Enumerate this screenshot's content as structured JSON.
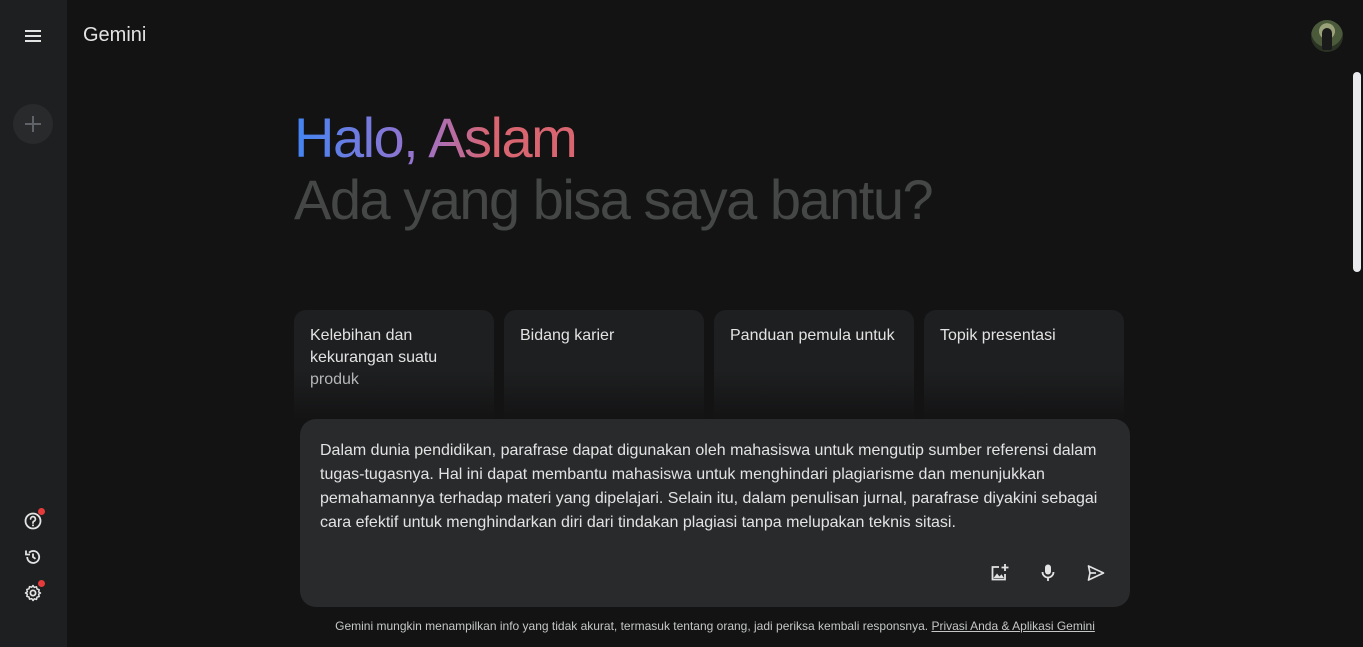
{
  "app": {
    "title": "Gemini"
  },
  "sidebar": {
    "menu_icon": "menu-icon",
    "new_chat_icon": "plus-icon",
    "bottom": [
      {
        "name": "help",
        "icon": "help-icon",
        "badge": true
      },
      {
        "name": "activity",
        "icon": "history-icon",
        "badge": false
      },
      {
        "name": "settings",
        "icon": "gear-icon",
        "badge": true
      }
    ]
  },
  "greeting": {
    "hello": "Halo, Aslam",
    "question": "Ada yang bisa saya bantu?"
  },
  "suggestions": [
    {
      "line": "Kelebihan dan kekurangan suatu",
      "faded": "produk"
    },
    {
      "line": "Bidang karier",
      "faded": ""
    },
    {
      "line": "Panduan pemula untuk",
      "faded": ""
    },
    {
      "line": "Topik presentasi",
      "faded": ""
    }
  ],
  "prompt": {
    "text": "Dalam dunia pendidikan, parafrase dapat digunakan oleh mahasiswa untuk mengutip sumber referensi dalam tugas-tugasnya. Hal ini dapat membantu mahasiswa untuk menghindari plagiarisme dan menunjukkan pemahamannya terhadap materi yang dipelajari. Selain itu, dalam penulisan jurnal, parafrase diyakini sebagai cara efektif untuk menghindarkan diri dari tindakan plagiasi tanpa melupakan teknis sitasi.",
    "actions": [
      "add-image-icon",
      "microphone-icon",
      "send-icon"
    ]
  },
  "footer": {
    "disclaimer": "Gemini mungkin menampilkan info yang tidak akurat, termasuk tentang orang, jadi periksa kembali responsnya.",
    "link": "Privasi Anda & Aplikasi Gemini"
  },
  "colors": {
    "background": "#131314",
    "sidebar": "#1e1f20",
    "prompt_bg": "#282a2c",
    "gradient": [
      "#4285f4",
      "#9b72cb",
      "#d96570"
    ],
    "badge": "#e63b3b"
  }
}
